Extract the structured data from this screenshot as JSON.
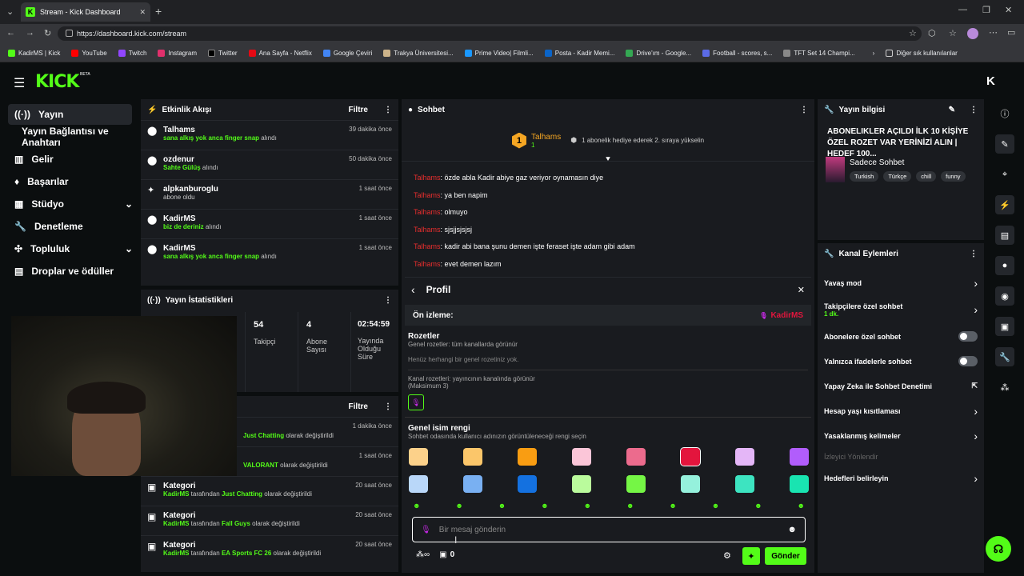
{
  "browser": {
    "tab_title": "Stream - Kick Dashboard",
    "url": "https://dashboard.kick.com/stream",
    "bookmarks": [
      "KadirMS | Kick",
      "YouTube",
      "Twitch",
      "Instagram",
      "Twitter",
      "Ana Sayfa - Netflix",
      "Google Çeviri",
      "Trakya Üniversitesi...",
      "Prime Video| Filmli...",
      "Posta - Kadir Memi...",
      "Drive'ım - Google...",
      "Football - scores, s...",
      "TFT Set 14 Champi..."
    ],
    "bookmarks_other": "Diğer sık kullanılanlar"
  },
  "brand": {
    "logo": "KICK",
    "beta": "BETA",
    "accent": "#53fc18"
  },
  "nav": {
    "items": [
      {
        "label": "Yayın",
        "icon": "broadcast-icon"
      },
      {
        "label": "Yayın Bağlantısı ve Anahtarı",
        "icon": ""
      },
      {
        "label": "Gelir",
        "icon": "revenue-icon"
      },
      {
        "label": "Başarılar",
        "icon": "trophy-icon"
      },
      {
        "label": "Stüdyo",
        "icon": "studio-icon"
      },
      {
        "label": "Denetleme",
        "icon": "wrench-icon"
      },
      {
        "label": "Topluluk",
        "icon": "community-icon"
      },
      {
        "label": "Droplar ve ödüller",
        "icon": "gift-icon"
      }
    ]
  },
  "activity": {
    "title": "Etkinlik Akışı",
    "filter": "Filtre",
    "items": [
      {
        "user": "Talhams",
        "detail": "sana alkış yok anca finger snap",
        "suffix": " alındı",
        "time": "39 dakika önce"
      },
      {
        "user": "ozdenur",
        "detail": "Sahte Gülüş",
        "suffix": " alındı",
        "time": "50 dakika önce"
      },
      {
        "user": "alpkanburoglu",
        "detail": "",
        "suffix": "abone oldu",
        "time": "1 saat önce"
      },
      {
        "user": "KadirMS",
        "detail": "biz de deriniz",
        "suffix": " alındı",
        "time": "1 saat önce"
      },
      {
        "user": "KadirMS",
        "detail": "sana alkış yok anca finger snap",
        "suffix": " alındı",
        "time": "1 saat önce"
      }
    ]
  },
  "stats": {
    "title": "Yayın İstatistikleri",
    "items": [
      {
        "value": "54",
        "label": "Takipçi"
      },
      {
        "value": "4",
        "label": "Abone Sayısı"
      },
      {
        "value": "02:54:59",
        "label": "Yayında Olduğu Süre"
      }
    ]
  },
  "activity2": {
    "filter": "Filtre",
    "partial": [
      {
        "text": "Just Chatting",
        "suffix": " olarak değiştirildi",
        "time": "1 dakika önce"
      },
      {
        "text": "VALORANT",
        "suffix": " olarak değiştirildi",
        "time": "1 saat önce"
      }
    ],
    "items": [
      {
        "title": "Kategori",
        "user": "KadirMS",
        "mid": " tarafından ",
        "cat": "Just Chatting",
        "suffix": " olarak değiştirildi",
        "time": "20 saat önce"
      },
      {
        "title": "Kategori",
        "user": "KadirMS",
        "mid": " tarafından ",
        "cat": "Fall Guys",
        "suffix": " olarak değiştirildi",
        "time": "20 saat önce"
      },
      {
        "title": "Kategori",
        "user": "KadirMS",
        "mid": " tarafından ",
        "cat": "EA Sports FC 26",
        "suffix": " olarak değiştirildi",
        "time": "20 saat önce"
      }
    ]
  },
  "chat": {
    "title": "Sohbet",
    "pinned_user": "Talhams",
    "pinned_rank": "1",
    "pinned_count": "1",
    "pinned_text": "1 abonelik hediye ederek 2. sıraya yükselin",
    "messages": [
      {
        "user": "Talhams",
        "text": ": özde abla Kadir abiye gaz veriyor oynamasın diye"
      },
      {
        "user": "Talhams",
        "text": ": ya ben napim"
      },
      {
        "user": "Talhams",
        "text": ": olmuyo"
      },
      {
        "user": "Talhams",
        "text": ": sjsjjsjsjsj"
      },
      {
        "user": "Talhams",
        "text": ": kadir abi bana şunu demen işte feraset işte adam gibi adam"
      },
      {
        "user": "Talhams",
        "text": ": evet demen lazım"
      }
    ],
    "input_placeholder": "Bir mesaj gönderin",
    "send": "Gönder",
    "points": "0"
  },
  "profile": {
    "title": "Profil",
    "preview_label": "Ön izleme:",
    "preview_user": "KadirMS",
    "badges_title": "Rozetler",
    "global_badges": "Genel rozetler: tüm kanallarda görünür",
    "no_badges": "Henüz herhangi bir genel rozetiniz yok.",
    "channel_badges": "Kanal rozetleri: yayıncının kanalında görünür",
    "max": "(Maksimum 3)",
    "color_title": "Genel isim rengi",
    "color_desc": "Sohbet odasında kullanıcı adınızın görüntüleneceği rengi seçin",
    "colors": [
      "#fcd18a",
      "#fbc66a",
      "#f99d12",
      "#fbc6d8",
      "#ec6b8d",
      "#e3153d",
      "#e4b6f7",
      "#b15dfc",
      "#b9d7f9",
      "#79b0f2",
      "#1471e0",
      "#bafb9c",
      "#75f645",
      "#95f1dc",
      "#3de4c1",
      "#19e4b1"
    ]
  },
  "info": {
    "title": "Yayın bilgisi",
    "stream_title": "ABONELIKLER AÇILDI İLK 10 KİŞİYE ÖZEL ROZET VAR YERİNİZİ ALIN | HEDEF 100...",
    "category": "Sadece Sohbet",
    "tags": [
      "Turkish",
      "Türkçe",
      "chill",
      "funny"
    ]
  },
  "channel_actions": {
    "title": "Kanal Eylemleri",
    "slow": "Yavaş mod",
    "followers": "Takipçilere özel sohbet",
    "followers_sub": "1 dk.",
    "subs": "Abonelere özel sohbet",
    "emotes": "Yalnızca ifadelerle sohbet",
    "ai": "Yapay Zeka ile Sohbet Denetimi",
    "age": "Hesap yaşı kısıtlaması",
    "banned": "Yasaklanmış kelimeler",
    "viewer_dir": "İzleyici Yönlendir",
    "goals": "Hedefleri belirleyin"
  }
}
